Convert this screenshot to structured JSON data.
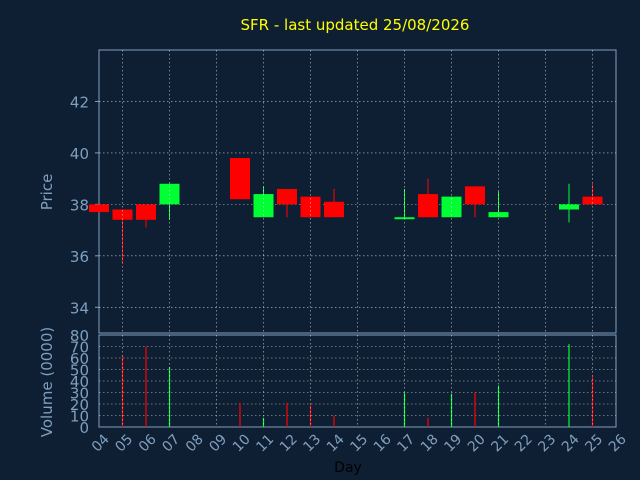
{
  "chart_data": [
    {
      "type": "candlestick",
      "title": "SFR - last updated 25/08/2026",
      "ylabel": "Price",
      "ylim": [
        33,
        44
      ],
      "yticks": [
        34,
        36,
        38,
        40,
        42
      ],
      "grid": true,
      "colors": {
        "up": "#00ff33",
        "down": "#ff0000",
        "background": "#0f1f33",
        "axis": "#7f9fbf",
        "title": "#ffff00"
      },
      "candles": [
        {
          "day": "04",
          "open": 38.0,
          "close": 37.7,
          "high": 38.0,
          "low": 37.7
        },
        {
          "day": "05",
          "open": 37.8,
          "close": 37.4,
          "high": 37.8,
          "low": 35.7
        },
        {
          "day": "06",
          "open": 38.0,
          "close": 37.4,
          "high": 38.0,
          "low": 37.1
        },
        {
          "day": "07",
          "open": 38.0,
          "close": 38.8,
          "high": 38.8,
          "low": 37.4
        },
        {
          "day": "10",
          "open": 39.8,
          "close": 38.2,
          "high": 39.8,
          "low": 38.2
        },
        {
          "day": "11",
          "open": 37.5,
          "close": 38.4,
          "high": 38.7,
          "low": 37.5
        },
        {
          "day": "12",
          "open": 38.6,
          "close": 38.0,
          "high": 38.6,
          "low": 37.5
        },
        {
          "day": "13",
          "open": 38.3,
          "close": 37.5,
          "high": 38.3,
          "low": 37.5
        },
        {
          "day": "14",
          "open": 38.1,
          "close": 37.5,
          "high": 38.6,
          "low": 37.5
        },
        {
          "day": "17",
          "open": 37.45,
          "close": 37.5,
          "high": 38.6,
          "low": 37.45
        },
        {
          "day": "18",
          "open": 38.4,
          "close": 37.5,
          "high": 39.0,
          "low": 37.5
        },
        {
          "day": "19",
          "open": 37.5,
          "close": 38.3,
          "high": 38.3,
          "low": 37.5
        },
        {
          "day": "20",
          "open": 38.7,
          "close": 38.0,
          "high": 38.7,
          "low": 37.5
        },
        {
          "day": "21",
          "open": 37.5,
          "close": 37.7,
          "high": 38.5,
          "low": 37.5
        },
        {
          "day": "24",
          "open": 37.8,
          "close": 38.0,
          "high": 38.8,
          "low": 37.3
        },
        {
          "day": "25",
          "open": 38.3,
          "close": 38.0,
          "high": 38.8,
          "low": 38.0
        }
      ]
    },
    {
      "type": "bar",
      "ylabel": "Volume (0000)",
      "xlabel": "Day",
      "ylim": [
        0,
        80
      ],
      "yticks": [
        0,
        10,
        20,
        30,
        40,
        50,
        60,
        70,
        80
      ],
      "grid": true,
      "categories": [
        "04",
        "05",
        "06",
        "07",
        "08",
        "09",
        "10",
        "11",
        "12",
        "13",
        "14",
        "15",
        "16",
        "17",
        "18",
        "19",
        "20",
        "21",
        "22",
        "23",
        "24",
        "25",
        "26"
      ],
      "bars": [
        {
          "day": "05",
          "value": 62,
          "color": "#ff0000"
        },
        {
          "day": "06",
          "value": 70,
          "color": "#ff0000"
        },
        {
          "day": "07",
          "value": 52,
          "color": "#00ff33"
        },
        {
          "day": "10",
          "value": 21,
          "color": "#ff0000"
        },
        {
          "day": "11",
          "value": 8,
          "color": "#00ff33"
        },
        {
          "day": "12",
          "value": 21,
          "color": "#ff0000"
        },
        {
          "day": "13",
          "value": 19,
          "color": "#ff0000"
        },
        {
          "day": "14",
          "value": 10,
          "color": "#ff0000"
        },
        {
          "day": "17",
          "value": 30,
          "color": "#00ff33"
        },
        {
          "day": "18",
          "value": 8,
          "color": "#ff0000"
        },
        {
          "day": "19",
          "value": 29,
          "color": "#00ff33"
        },
        {
          "day": "20",
          "value": 30,
          "color": "#ff0000"
        },
        {
          "day": "21",
          "value": 36,
          "color": "#00ff33"
        },
        {
          "day": "24",
          "value": 72,
          "color": "#00ff33"
        },
        {
          "day": "25",
          "value": 44,
          "color": "#ff0000"
        }
      ]
    }
  ]
}
